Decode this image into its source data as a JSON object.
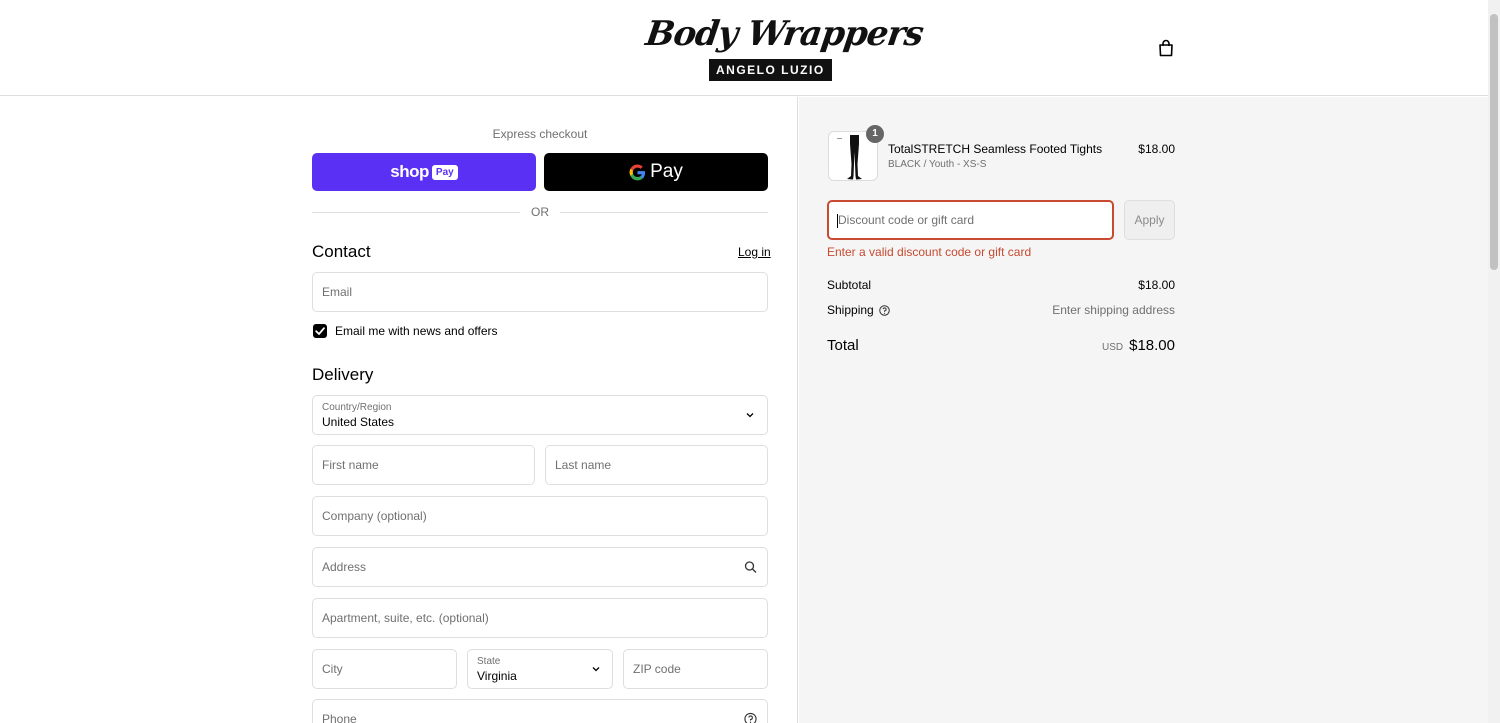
{
  "header": {
    "logo_script": "Body Wrappers",
    "logo_sub": "ANGELO LUZIO",
    "cart_icon": "shopping-bag-icon"
  },
  "express": {
    "label": "Express checkout",
    "shop_pay_text": "shop",
    "shop_pay_badge": "Pay",
    "gpay_text": "Pay",
    "or_text": "OR"
  },
  "contact": {
    "title": "Contact",
    "login_label": "Log in",
    "email_placeholder": "Email",
    "newsletter_label": "Email me with news and offers",
    "newsletter_checked": true
  },
  "delivery": {
    "title": "Delivery",
    "country_label": "Country/Region",
    "country_value": "United States",
    "first_name_placeholder": "First name",
    "last_name_placeholder": "Last name",
    "company_placeholder": "Company (optional)",
    "address_placeholder": "Address",
    "apartment_placeholder": "Apartment, suite, etc. (optional)",
    "city_placeholder": "City",
    "state_label": "State",
    "state_value": "Virginia",
    "zip_placeholder": "ZIP code",
    "phone_placeholder": "Phone"
  },
  "order": {
    "product_name": "TotalSTRETCH Seamless Footed Tights",
    "product_variant": "BLACK / Youth - XS-S",
    "product_price": "$18.00",
    "quantity": "1",
    "discount_placeholder": "Discount code or gift card",
    "apply_label": "Apply",
    "error_message": "Enter a valid discount code or gift card",
    "subtotal_label": "Subtotal",
    "subtotal_value": "$18.00",
    "shipping_label": "Shipping",
    "shipping_value": "Enter shipping address",
    "total_label": "Total",
    "currency": "USD",
    "total_value": "$18.00"
  },
  "colors": {
    "shop_pay": "#5a31f4",
    "error": "#c74a31",
    "summary_bg": "#f5f5f5"
  }
}
